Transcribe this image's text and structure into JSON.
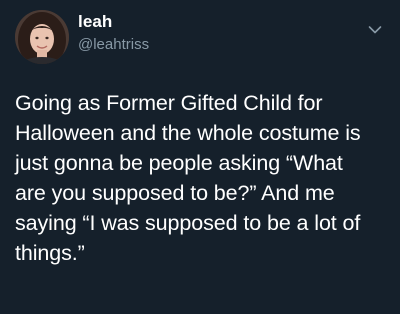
{
  "user": {
    "display_name": "leah",
    "handle": "@leahtriss",
    "avatar_icon": "profile-photo"
  },
  "menu": {
    "icon": "chevron-down-icon"
  },
  "tweet": {
    "lines": [
      "Going as Former Gifted Child for",
      "Halloween and the whole costume is",
      "just gonna be people asking “What",
      "are you supposed to be?” And me",
      "saying “I was supposed to be a lot of",
      "things.”"
    ]
  },
  "colors": {
    "background": "#15202b",
    "primary_text": "#ffffff",
    "secondary_text": "#8899a6"
  }
}
